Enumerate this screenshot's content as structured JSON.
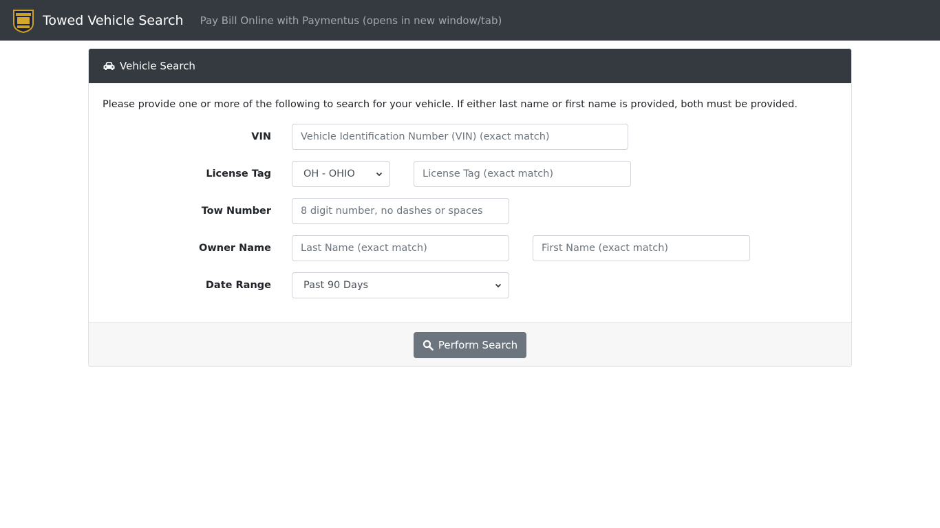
{
  "navbar": {
    "logo_icon": "police-badge-icon",
    "brand": "Towed Vehicle Search",
    "link": "Pay Bill Online with Paymentus (opens in new window/tab)"
  },
  "card": {
    "header_icon": "car-icon",
    "header": "Vehicle Search",
    "intro": "Please provide one or more of the following to search for your vehicle. If either last name or first name is provided, both must be provided.",
    "fields": {
      "vin": {
        "label": "VIN",
        "placeholder": "Vehicle Identification Number (VIN) (exact match)",
        "value": ""
      },
      "license_tag": {
        "label": "License Tag",
        "state_selected": "OH - OHIO",
        "placeholder": "License Tag (exact match)",
        "value": ""
      },
      "tow_number": {
        "label": "Tow Number",
        "placeholder": "8 digit number, no dashes or spaces",
        "value": ""
      },
      "owner_name": {
        "label": "Owner Name",
        "last_placeholder": "Last Name (exact match)",
        "first_placeholder": "First Name (exact match)"
      },
      "date_range": {
        "label": "Date Range",
        "selected": "Past 90 Days"
      }
    },
    "submit_icon": "search-icon",
    "submit": "Perform Search"
  },
  "colors": {
    "navbar": "#343a40",
    "button": "#6c757d"
  }
}
